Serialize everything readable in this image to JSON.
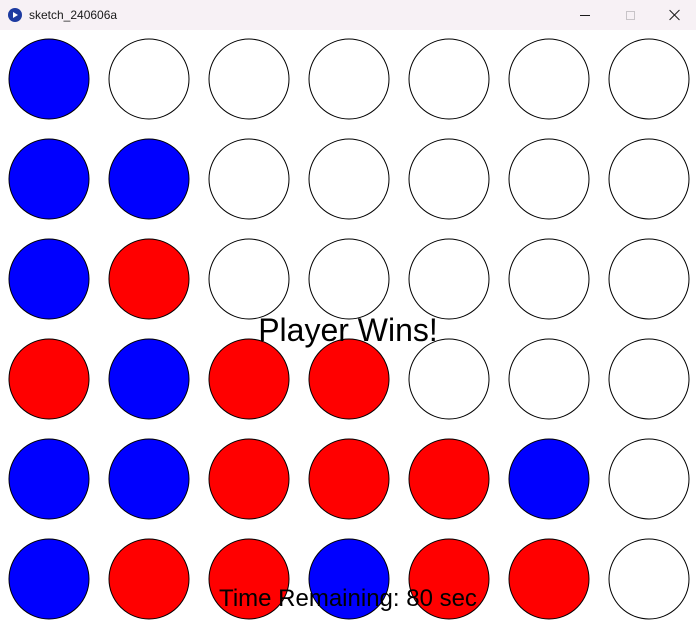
{
  "window": {
    "title": "sketch_240606a",
    "app_icon": "processing-play-icon",
    "controls": {
      "minimize_icon": "minimize-icon",
      "maximize_icon": "maximize-icon",
      "close_icon": "close-icon"
    }
  },
  "game": {
    "status_message": "Player Wins!",
    "timer_text": "Time Remaining: 80 sec",
    "colors": {
      "blue": "#0000ff",
      "red": "#ff0000",
      "empty": "#ffffff",
      "outline": "#000000"
    },
    "board": [
      [
        "blue",
        "empty",
        "empty",
        "empty",
        "empty",
        "empty",
        "empty"
      ],
      [
        "blue",
        "blue",
        "empty",
        "empty",
        "empty",
        "empty",
        "empty"
      ],
      [
        "blue",
        "red",
        "empty",
        "empty",
        "empty",
        "empty",
        "empty"
      ],
      [
        "red",
        "blue",
        "red",
        "red",
        "empty",
        "empty",
        "empty"
      ],
      [
        "blue",
        "blue",
        "red",
        "red",
        "red",
        "blue",
        "empty"
      ],
      [
        "blue",
        "red",
        "red",
        "blue",
        "red",
        "red",
        "empty"
      ]
    ]
  }
}
